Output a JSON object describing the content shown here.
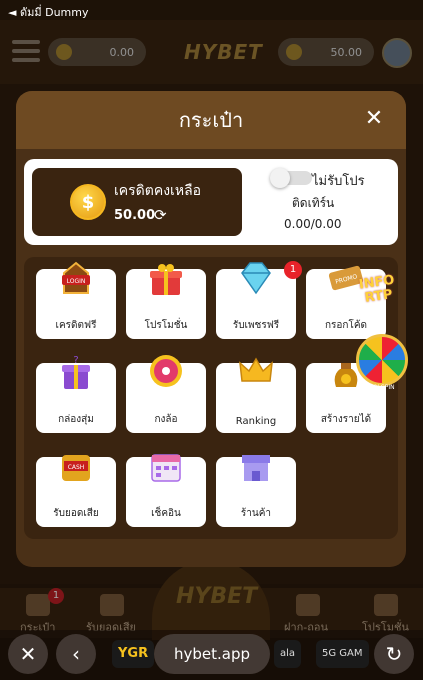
{
  "status_bar": {
    "back_text": "◄ ดัมมี่ Dummy"
  },
  "header": {
    "left_balance": "0.00",
    "logo": "HYBET",
    "right_balance": "50.00"
  },
  "modal": {
    "title": "กระเป๋า",
    "close_icon": "close-icon",
    "credit": {
      "label": "เครดิตคงเหลือ",
      "value": "50.00",
      "coin_symbol": "$"
    },
    "promo_toggle_label": "ไม่รับโปร",
    "turnover_label": "ติดเทิร์น",
    "turnover_value": "0.00/0.00"
  },
  "tiles": [
    {
      "label": "เครดิตฟรี",
      "icon": "login-bonus-icon"
    },
    {
      "label": "โปรโมชั่น",
      "icon": "gift-box-icon"
    },
    {
      "label": "รับเพชรฟรี",
      "icon": "diamond-icon",
      "badge": "1"
    },
    {
      "label": "กรอกโค้ด",
      "icon": "promo-ticket-icon"
    },
    {
      "label": "กล่องสุ่ม",
      "icon": "mystery-box-icon"
    },
    {
      "label": "กงล้อ",
      "icon": "wheel-icon"
    },
    {
      "label": "Ranking",
      "icon": "crown-icon"
    },
    {
      "label": "สร้างรายได้",
      "icon": "money-bag-icon"
    },
    {
      "label": "รับยอดเสีย",
      "icon": "cash-back-icon"
    },
    {
      "label": "เช็คอิน",
      "icon": "calendar-icon"
    },
    {
      "label": "ร้านค้า",
      "icon": "shop-icon"
    }
  ],
  "floating": {
    "info_rtp": "INFO RTP",
    "lucky_spin": "LUCKY SPIN"
  },
  "bottom_nav": {
    "items": [
      "กระเป๋า",
      "รับยอดเสีย",
      "ฝาก-ถอน",
      "โปรโมชั่น"
    ],
    "wallet_badge": "1",
    "center_logo": "HYBET"
  },
  "browser": {
    "url": "hybet.app",
    "chips": [
      "YGR",
      "ala",
      "5G GAM"
    ]
  },
  "colors": {
    "modal_bg": "#4a3017",
    "header_bg": "#6e4a22",
    "accent_gold": "#f6b820",
    "badge_red": "#e8232a"
  }
}
